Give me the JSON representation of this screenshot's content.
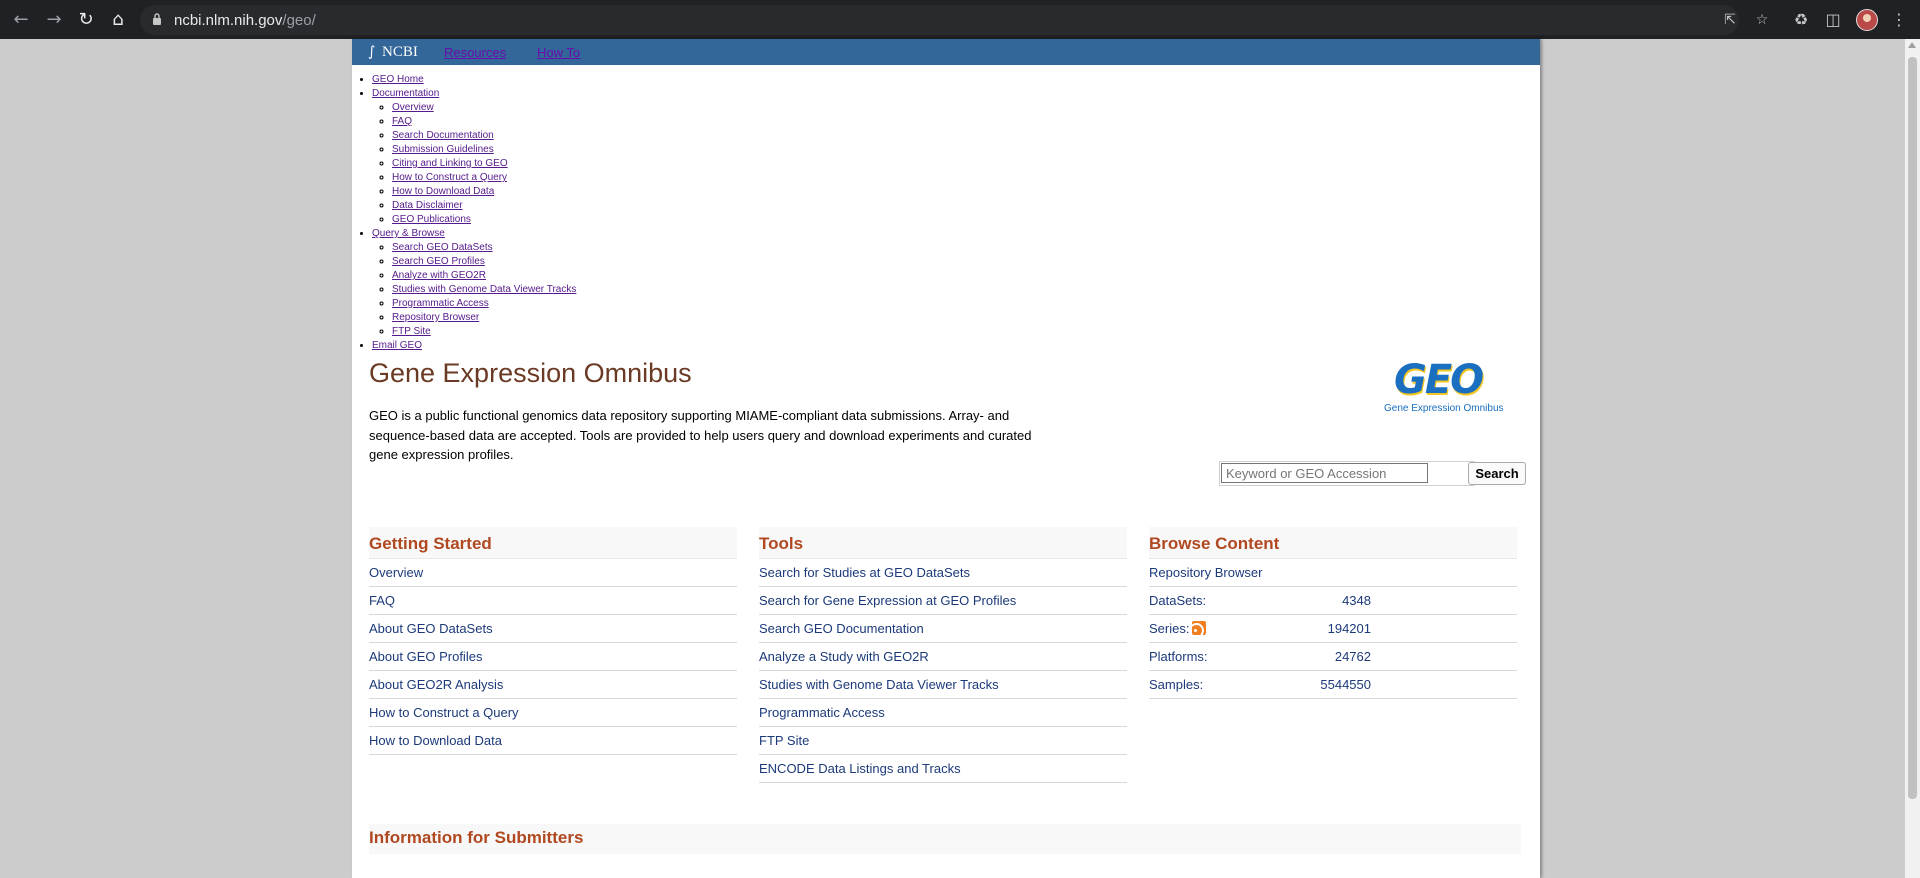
{
  "browser": {
    "url_host": "ncbi.nlm.nih.gov",
    "url_path": "/geo/",
    "icons": [
      "back-icon",
      "forward-icon",
      "reload-icon",
      "home-icon",
      "lock-icon",
      "share-icon",
      "star-icon",
      "extensions-icon",
      "side-panel-icon",
      "avatar",
      "menu-icon"
    ]
  },
  "topbar": {
    "logo_text": "NCBI",
    "links": [
      "Resources",
      "How To"
    ]
  },
  "sitemap": {
    "geo_home": "GEO Home",
    "documentation": "Documentation",
    "doc_items": [
      "Overview",
      "FAQ",
      "Search Documentation",
      "Submission Guidelines",
      "Citing and Linking to GEO",
      "How to Construct a Query",
      "How to Download Data",
      "Data Disclaimer",
      "GEO Publications"
    ],
    "query_browse": "Query & Browse",
    "qb_items": [
      "Search GEO DataSets",
      "Search GEO Profiles",
      "Analyze with GEO2R",
      "Studies with Genome Data Viewer Tracks",
      "Programmatic Access",
      "Repository Browser",
      "FTP Site"
    ],
    "email": "Email GEO"
  },
  "main": {
    "title": "Gene Expression Omnibus",
    "description": "GEO is a public functional genomics data repository supporting MIAME-compliant data submissions. Array- and sequence-based data are accepted. Tools are provided to help users query and download experiments and curated gene expression profiles.",
    "logo_word": "GEO",
    "logo_tagline": "Gene Expression Omnibus"
  },
  "search": {
    "placeholder": "Keyword or GEO Accession",
    "value": "",
    "button": "Search"
  },
  "getting_started": {
    "heading": "Getting Started",
    "items": [
      "Overview",
      "FAQ",
      "About GEO DataSets",
      "About GEO Profiles",
      "About GEO2R Analysis",
      "How to Construct a Query",
      "How to Download Data"
    ]
  },
  "tools": {
    "heading": "Tools",
    "items": [
      "Search for Studies at GEO DataSets",
      "Search for Gene Expression at GEO Profiles",
      "Search GEO Documentation",
      "Analyze a Study with GEO2R",
      "Studies with Genome Data Viewer Tracks",
      "Programmatic Access",
      "FTP Site",
      "ENCODE Data Listings and Tracks"
    ]
  },
  "browse": {
    "heading": "Browse Content",
    "repository_browser": "Repository Browser",
    "stats": [
      {
        "label": "DataSets:",
        "value": "4348"
      },
      {
        "label": "Series:",
        "value": "194201",
        "rss": true
      },
      {
        "label": "Platforms:",
        "value": "24762"
      },
      {
        "label": "Samples:",
        "value": "5544550"
      }
    ]
  },
  "info_heading": "Information for Submitters",
  "colors": {
    "topbar": "#336699",
    "title": "#6b3a24",
    "section_heading": "#b04820",
    "link": "#1c3a7a"
  }
}
